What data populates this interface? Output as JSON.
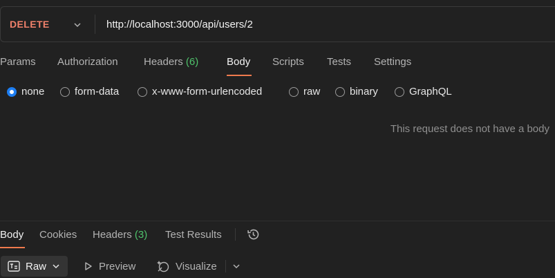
{
  "request": {
    "method": "DELETE",
    "url": "http://localhost:3000/api/users/2"
  },
  "req_tabs": [
    {
      "label": "Params"
    },
    {
      "label": "Authorization"
    },
    {
      "label": "Headers",
      "count": "(6)"
    },
    {
      "label": "Body",
      "active": true
    },
    {
      "label": "Scripts"
    },
    {
      "label": "Tests"
    },
    {
      "label": "Settings"
    }
  ],
  "body_types": [
    {
      "label": "none",
      "checked": true
    },
    {
      "label": "form-data"
    },
    {
      "label": "x-www-form-urlencoded"
    },
    {
      "label": "raw"
    },
    {
      "label": "binary"
    },
    {
      "label": "GraphQL"
    }
  ],
  "empty_message": "This request does not have a body",
  "resp_tabs": [
    {
      "label": "Body",
      "active": true
    },
    {
      "label": "Cookies"
    },
    {
      "label": "Headers",
      "count": "(3)"
    },
    {
      "label": "Test Results"
    }
  ],
  "toolbar": {
    "raw_label": "Raw",
    "preview_label": "Preview",
    "visualize_label": "Visualize"
  },
  "colors": {
    "method": "#f0816b",
    "accent": "#f07a4d",
    "radio_selected": "#1d7ef2",
    "count": "#4fc26b"
  },
  "icons": [
    "chevron-down-icon",
    "history-icon",
    "raw-format-icon",
    "play-icon",
    "visualize-icon"
  ]
}
